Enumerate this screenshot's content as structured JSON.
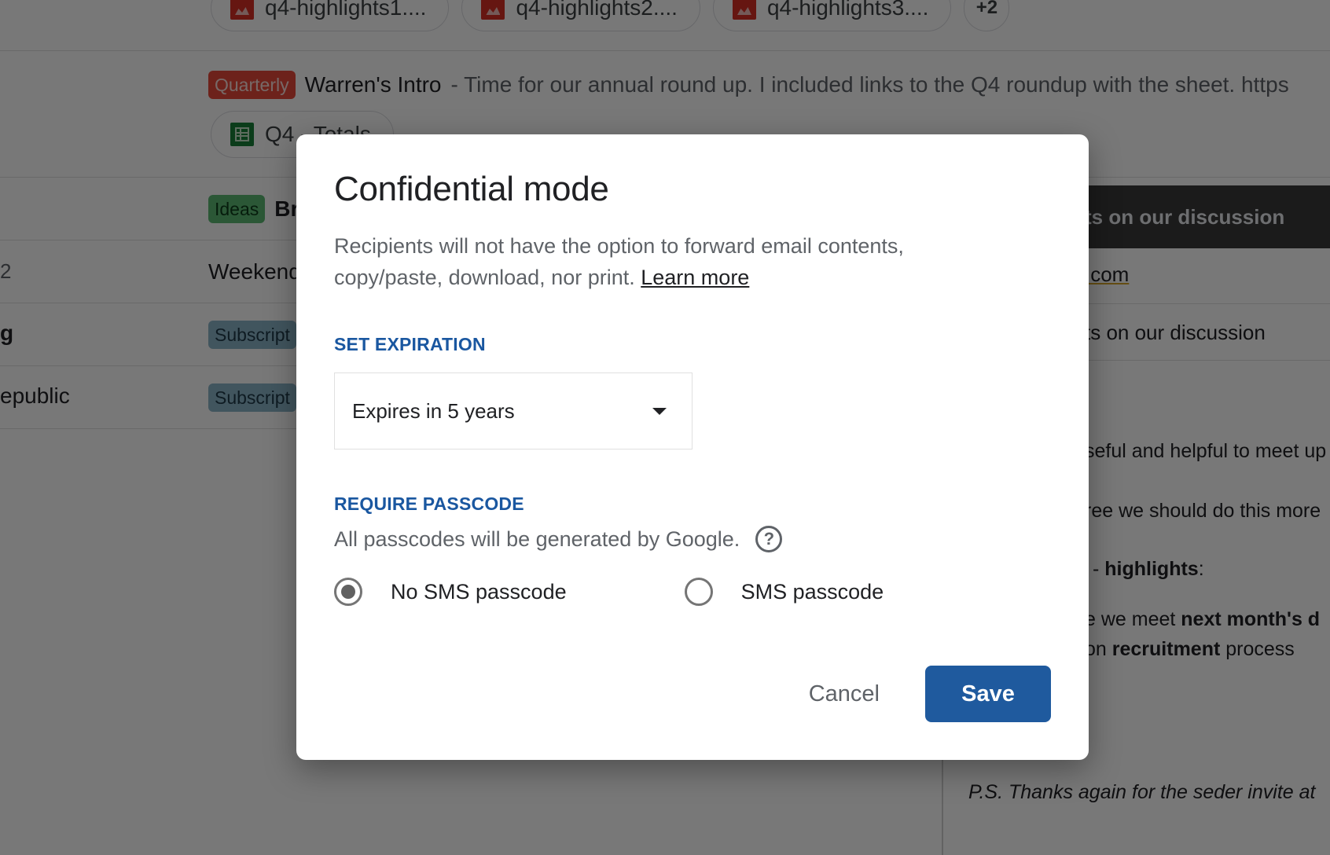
{
  "background": {
    "attachments": [
      {
        "name": "q4-highlights1....",
        "type": "image-icon"
      },
      {
        "name": "q4-highlights2....",
        "type": "image-icon"
      },
      {
        "name": "q4-highlights3....",
        "type": "image-icon"
      }
    ],
    "attachments_more": "+2",
    "rows": [
      {
        "label": "Quarterly",
        "subject": "Warren's Intro",
        "snippet": "- Time for our annual round up. I included links to the Q4 roundup with the sheet. https",
        "attachment": {
          "name": "Q4 - Totals",
          "type": "spreadsheet-icon"
        }
      },
      {
        "label": "Ideas",
        "subject": "Br"
      },
      {
        "sender": "2",
        "subject": "Weekend"
      },
      {
        "sender": "g",
        "label": "Subscript"
      },
      {
        "sender": "epublic",
        "label": "Subscript"
      }
    ],
    "reading_pane": {
      "header": "ts on our discussion",
      "email": ".com",
      "subject_line": "ts on our discussion",
      "body": [
        {
          "text": "seful and helpful to meet up"
        },
        {
          "text": "ree we should do this more"
        },
        {
          "prefix": "- ",
          "bold": "highlights",
          "suffix": ":"
        },
        {
          "prefix": "e we meet ",
          "bold": "next month's d",
          "suffix": ""
        },
        {
          "prefix": "on ",
          "bold": "recruitment",
          "suffix": " process"
        }
      ],
      "ps": "P.S. Thanks again for the seder invite at"
    }
  },
  "dialog": {
    "title": "Confidential mode",
    "description": "Recipients will not have the option to forward email contents, copy/paste, download, nor print.",
    "learn_more": "Learn more",
    "expiration": {
      "heading": "SET EXPIRATION",
      "selected": "Expires in 5 years"
    },
    "passcode": {
      "heading": "REQUIRE PASSCODE",
      "note": "All passcodes will be generated by Google.",
      "options": [
        {
          "label": "No SMS passcode",
          "checked": true
        },
        {
          "label": "SMS passcode",
          "checked": false
        }
      ]
    },
    "cancel_label": "Cancel",
    "save_label": "Save"
  },
  "colors": {
    "accent": "#1f5a9e",
    "section_heading": "#1a57a0",
    "quarterly_label": "#e8493a",
    "ideas_label": "#5bb974",
    "subscriptions_label": "#8ab4c8"
  }
}
